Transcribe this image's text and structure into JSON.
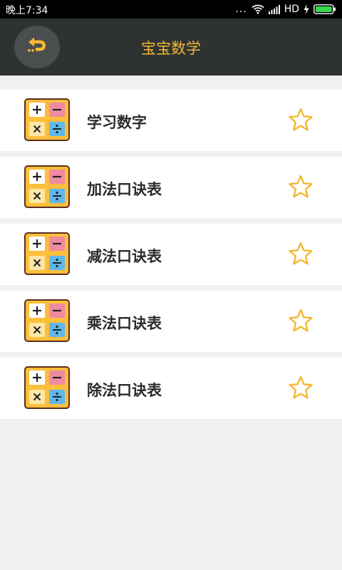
{
  "status_bar": {
    "time": "晚上7:34",
    "dots": "...",
    "network": "HD",
    "icons": [
      "wifi-icon",
      "signal-icon",
      "charging-icon",
      "battery-icon"
    ]
  },
  "app_bar": {
    "title": "宝宝数学",
    "back_icon": "back-arrow-icon"
  },
  "menu": {
    "items": [
      {
        "label": "学习数字",
        "icon": "math-operators-icon",
        "favorite_icon": "star-outline-icon"
      },
      {
        "label": "加法口诀表",
        "icon": "math-operators-icon",
        "favorite_icon": "star-outline-icon"
      },
      {
        "label": "减法口诀表",
        "icon": "math-operators-icon",
        "favorite_icon": "star-outline-icon"
      },
      {
        "label": "乘法口诀表",
        "icon": "math-operators-icon",
        "favorite_icon": "star-outline-icon"
      },
      {
        "label": "除法口诀表",
        "icon": "math-operators-icon",
        "favorite_icon": "star-outline-icon"
      }
    ]
  },
  "colors": {
    "app_bar": "#2e3232",
    "accent": "#f5b731",
    "background": "#f1f1f4",
    "tile_plus": "#ffffff",
    "tile_minus": "#ef8aa0",
    "tile_times": "#fce7a6",
    "tile_divide": "#5fb7ee",
    "tile_bg": "#fbbf3b"
  }
}
